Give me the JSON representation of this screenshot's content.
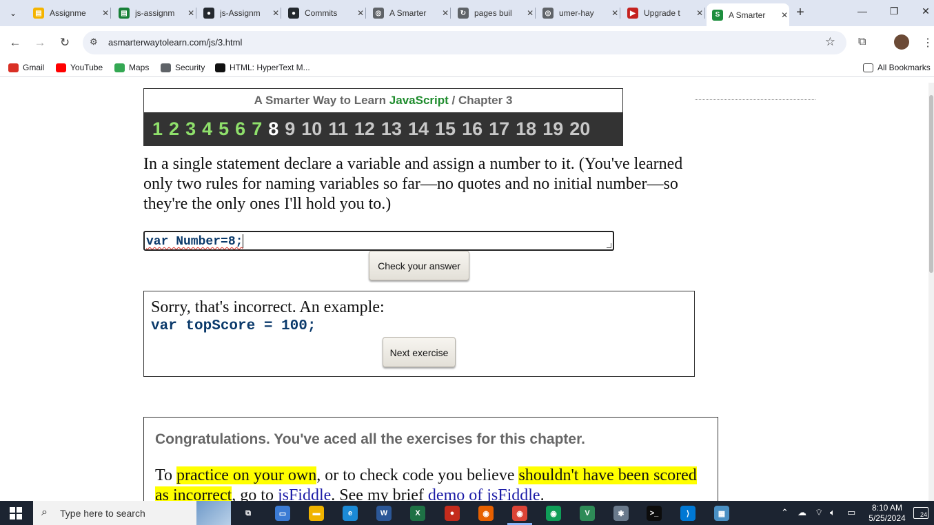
{
  "browser": {
    "tabs": [
      {
        "label": "Assignme",
        "color": "#f4b400",
        "glyph": "▤"
      },
      {
        "label": "js-assignm",
        "color": "#188038",
        "glyph": "▤"
      },
      {
        "label": "js-Assignm",
        "color": "#24292f",
        "glyph": "●"
      },
      {
        "label": "Commits",
        "color": "#24292f",
        "glyph": "●"
      },
      {
        "label": "A Smarter",
        "color": "#5f6368",
        "glyph": "◎"
      },
      {
        "label": "pages buil",
        "color": "#5f6368",
        "glyph": "↻"
      },
      {
        "label": "umer-hay",
        "color": "#5f6368",
        "glyph": "◎"
      },
      {
        "label": "Upgrade t",
        "color": "#c5221f",
        "glyph": "▶"
      },
      {
        "label": "A Smarter",
        "color": "#1e8e3e",
        "glyph": "S",
        "active": true
      }
    ],
    "url": "asmarterwaytolearn.com/js/3.html",
    "bookmarks": [
      {
        "label": "Gmail",
        "color": "#d93025"
      },
      {
        "label": "YouTube",
        "color": "#ff0000"
      },
      {
        "label": "Maps",
        "color": "#34a853"
      },
      {
        "label": "Security",
        "color": "#5f6368"
      },
      {
        "label": "HTML: HyperText M...",
        "color": "#111111"
      }
    ],
    "all_bookmarks": "All Bookmarks"
  },
  "chapter": {
    "prefix": "A Smarter Way to Learn",
    "brand": "JavaScript",
    "sep": " / ",
    "chapter_label": "Chapter 3",
    "numbers": [
      "1",
      "2",
      "3",
      "4",
      "5",
      "6",
      "7",
      "8",
      "9",
      "10",
      "11",
      "12",
      "13",
      "14",
      "15",
      "16",
      "17",
      "18",
      "19",
      "20"
    ],
    "completed_through": 7,
    "current": 8
  },
  "question": "In a single statement declare a variable and assign a number to it. (You've learned only two rules for naming variables so far—no quotes and no initial number—so they're the only ones I'll hold you to.)",
  "answer_value": "var Number=8;",
  "check_button": "Check your answer",
  "feedback": {
    "message": "Sorry, that's incorrect. An example:",
    "example_code": "var topScore = 100;",
    "next_button": "Next exercise"
  },
  "congrats": {
    "heading": "Congratulations. You've aced all the exercises for this chapter.",
    "p_1": "To ",
    "p_hl_1": "practice on your own",
    "p_2": ", or to check code you believe ",
    "p_hl_2": "shouldn't have been scored as incorrect",
    "p_3": ", go to ",
    "p_link_1": "jsFiddle",
    "p_4": ". See my brief ",
    "p_link_2": "demo of jsFiddle",
    "p_5": "."
  },
  "taskbar": {
    "search_placeholder": "Type here to search",
    "time": "8:10 AM",
    "date": "5/25/2024",
    "notifications": "24",
    "apps": [
      {
        "name": "task-view",
        "color": "#1c2431",
        "glyph": "⧉"
      },
      {
        "name": "file-manager",
        "color": "#3b7bd4",
        "glyph": "▭"
      },
      {
        "name": "explorer",
        "color": "#f0b400",
        "glyph": "▬"
      },
      {
        "name": "edge",
        "color": "#1b8ad6",
        "glyph": "e"
      },
      {
        "name": "word",
        "color": "#2b5797",
        "glyph": "W"
      },
      {
        "name": "excel",
        "color": "#1e7145",
        "glyph": "X"
      },
      {
        "name": "recorder",
        "color": "#c42b1c",
        "glyph": "●"
      },
      {
        "name": "firefox",
        "color": "#e66000",
        "glyph": "◉"
      },
      {
        "name": "chrome",
        "color": "#db4437",
        "glyph": "◉"
      },
      {
        "name": "chrome-2",
        "color": "#0f9d58",
        "glyph": "◉"
      },
      {
        "name": "vim",
        "color": "#2e8b57",
        "glyph": "V"
      },
      {
        "name": "bug-tool",
        "color": "#6a7a8c",
        "glyph": "✱"
      },
      {
        "name": "terminal",
        "color": "#0c0c0c",
        "glyph": ">_"
      },
      {
        "name": "vscode",
        "color": "#0078d4",
        "glyph": "⟩"
      },
      {
        "name": "notepad",
        "color": "#4a90c4",
        "glyph": "▦"
      }
    ]
  }
}
